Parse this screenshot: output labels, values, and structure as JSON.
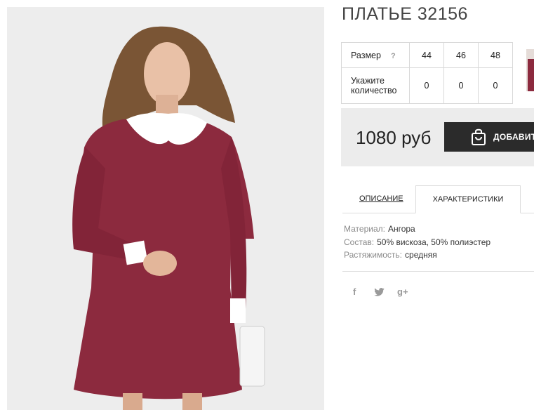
{
  "product": {
    "title": "ПЛАТЬЕ 32156",
    "price": "1080 руб",
    "add_to_cart": "ДОБАВИТЬ"
  },
  "size_table": {
    "size_label": "Размер",
    "help_icon": "?",
    "qty_label_1": "Укажите",
    "qty_label_2": "количество",
    "sizes": [
      "44",
      "46",
      "48"
    ],
    "quantities": [
      "0",
      "0",
      "0"
    ]
  },
  "tabs": {
    "description": "ОПИСАНИЕ",
    "characteristics": "ХАРАКТЕРИСТИКИ"
  },
  "specs": [
    {
      "key": "Материал:",
      "value": "Ангора"
    },
    {
      "key": "Состав:",
      "value": "50% вискоза, 50% полиэстер"
    },
    {
      "key": "Растяжимость:",
      "value": "средняя"
    }
  ],
  "social": {
    "facebook": "f",
    "twitter": "twitter-icon",
    "gplus": "g+"
  },
  "colors": {
    "dress": "#8c2a3e",
    "button": "#2b2b2b",
    "price_bg": "#ececec"
  }
}
